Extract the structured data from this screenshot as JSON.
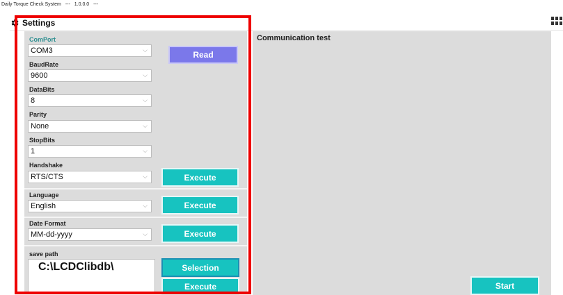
{
  "app": {
    "title": "Daily Torque Check System",
    "sep1": "---",
    "version": "1.0.0.0",
    "sep2": "---"
  },
  "tab": {
    "label": "Settings",
    "icon": "gear-icon"
  },
  "menu_icon": "grid-menu-icon",
  "settings": {
    "comport": {
      "label": "ComPort",
      "value": "COM3"
    },
    "baudrate": {
      "label": "BaudRate",
      "value": "9600"
    },
    "databits": {
      "label": "DataBits",
      "value": "8"
    },
    "parity": {
      "label": "Parity",
      "value": "None"
    },
    "stopbits": {
      "label": "StopBits",
      "value": "1"
    },
    "handshake": {
      "label": "Handshake",
      "value": "RTS/CTS"
    },
    "read_button": "Read",
    "serial_execute_button": "Execute",
    "language": {
      "label": "Language",
      "value": "English",
      "execute_button": "Execute"
    },
    "date_format": {
      "label": "Date Format",
      "value": "MM-dd-yyyy",
      "execute_button": "Execute"
    },
    "save_path": {
      "label": "save path",
      "value": "C:\\LCDClibdb\\",
      "selection_button": "Selection",
      "execute_button": "Execute"
    }
  },
  "communication": {
    "title": "Communication test",
    "start_button": "Start"
  },
  "colors": {
    "panel_bg": "#dcdcdc",
    "read_button": "#7b78ea",
    "execute_button": "#17c3c0",
    "label_accent": "#2f8f90",
    "highlight_border": "#ee0000"
  }
}
